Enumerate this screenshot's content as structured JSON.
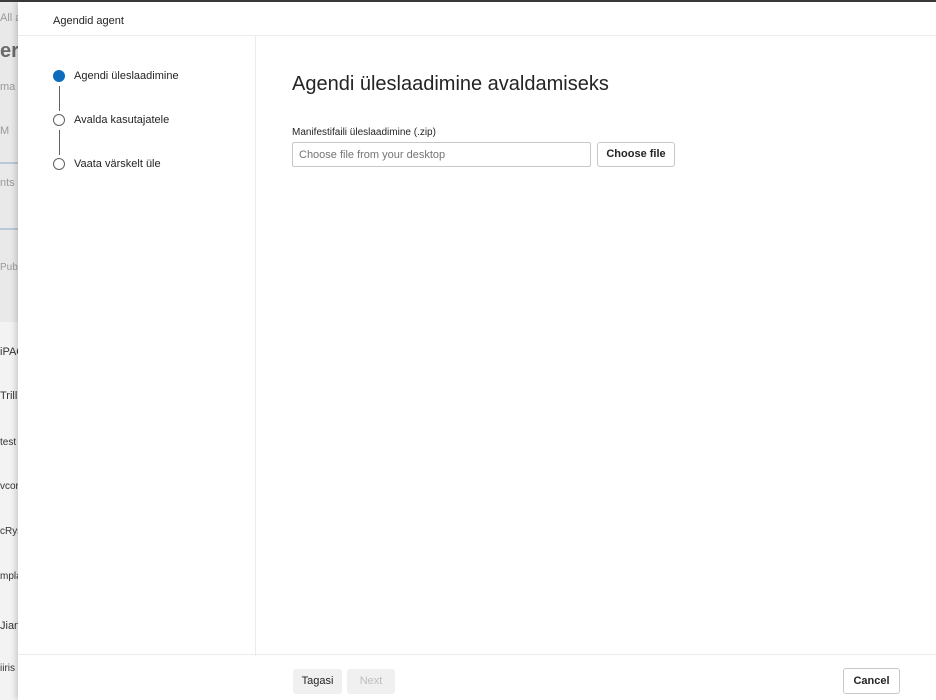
{
  "background_page": {
    "items": [
      "All a",
      "er",
      "ma",
      "M",
      "nts (",
      "Pub",
      "iPAQ",
      "Trill",
      "test",
      "vcor",
      "cRys",
      "mpla",
      "Jian",
      "iiris"
    ]
  },
  "panel": {
    "title": "Agendid agent",
    "steps": [
      {
        "label": "Agendi üleslaadimine",
        "state": "active"
      },
      {
        "label": "Avalda kasutajatele",
        "state": "pending"
      },
      {
        "label": "Vaata värskelt üle",
        "state": "pending"
      }
    ],
    "heading": "Agendi üleslaadimine avaldamiseks",
    "field": {
      "label": "Manifestifaili üleslaadimine (.zip)",
      "placeholder": "Choose file from your desktop",
      "button": "Choose file"
    },
    "footer": {
      "back": "Tagasi",
      "next": "Next",
      "cancel": "Cancel"
    }
  },
  "colors": {
    "accent": "#0f6cbd"
  }
}
